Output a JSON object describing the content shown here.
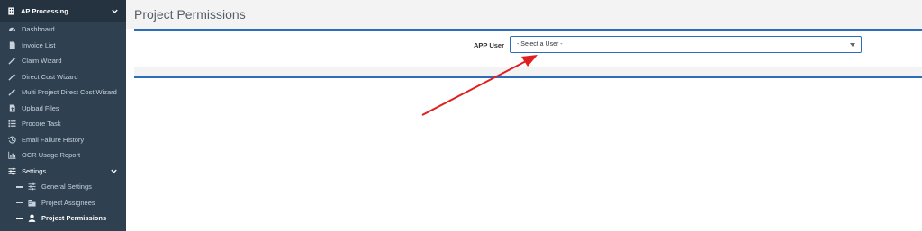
{
  "sidebar": {
    "header": {
      "label": "AP Processing",
      "icon": "building-icon"
    },
    "items": [
      {
        "label": "Dashboard",
        "icon": "dashboard-icon"
      },
      {
        "label": "Invoice List",
        "icon": "file-icon"
      },
      {
        "label": "Claim Wizard",
        "icon": "wand-icon"
      },
      {
        "label": "Direct Cost Wizard",
        "icon": "wand-icon"
      },
      {
        "label": "Multi Project Direct Cost Wizard",
        "icon": "wand-icon"
      },
      {
        "label": "Upload Files",
        "icon": "upload-file-icon"
      },
      {
        "label": "Procore Task",
        "icon": "list-icon"
      },
      {
        "label": "Email Failure History",
        "icon": "history-icon"
      },
      {
        "label": "OCR Usage Report",
        "icon": "bar-chart-icon"
      }
    ],
    "settings": {
      "label": "Settings",
      "icon": "sliders-icon",
      "subitems": [
        {
          "label": "General Settings",
          "icon": "sliders-icon"
        },
        {
          "label": "Project Assignees",
          "icon": "buildings-icon"
        },
        {
          "label": "Project Permissions",
          "icon": "user-icon"
        }
      ]
    }
  },
  "main": {
    "title": "Project Permissions",
    "form": {
      "app_user_label": "APP User",
      "app_user_selected": "- Select a User -"
    }
  },
  "colors": {
    "sidebar_bg": "#2f4050",
    "accent": "#2a6ebb",
    "annotation_arrow": "#e02020"
  }
}
